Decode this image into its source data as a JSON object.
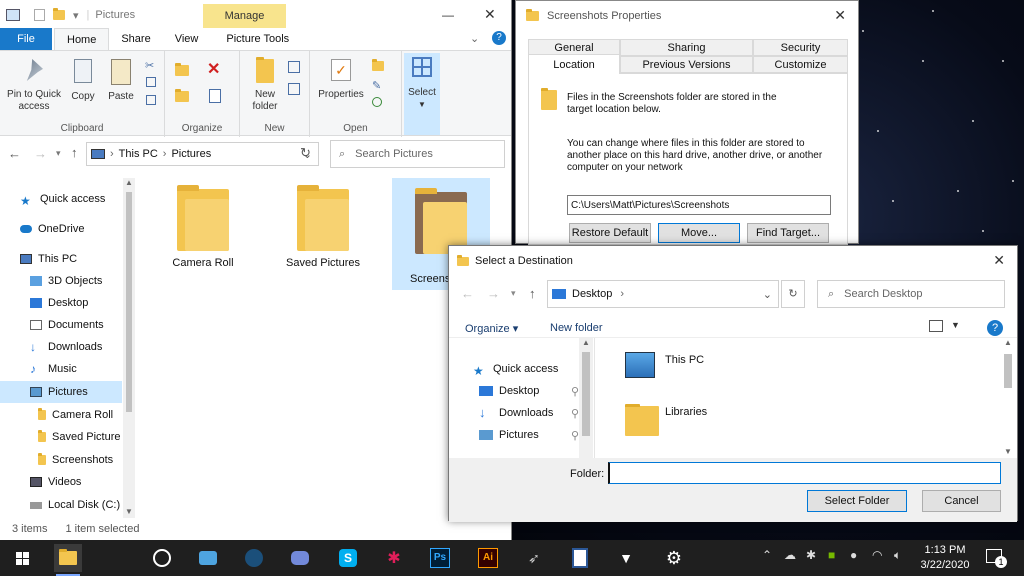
{
  "explorer": {
    "title": "Pictures",
    "manage_label": "Manage",
    "tabs": [
      "File",
      "Home",
      "Share",
      "View",
      "Picture Tools"
    ],
    "ribbon": {
      "pin": "Pin to Quick access",
      "copy": "Copy",
      "paste": "Paste",
      "new_folder": "New folder",
      "properties": "Properties",
      "select": "Select",
      "groups": [
        "Clipboard",
        "Organize",
        "New",
        "Open"
      ]
    },
    "address": {
      "parts": [
        "This PC",
        "Pictures"
      ]
    },
    "search_placeholder": "Search Pictures",
    "nav": [
      {
        "label": "Quick access"
      },
      {
        "label": "OneDrive"
      },
      {
        "label": "This PC"
      },
      {
        "label": "3D Objects"
      },
      {
        "label": "Desktop"
      },
      {
        "label": "Documents"
      },
      {
        "label": "Downloads"
      },
      {
        "label": "Music"
      },
      {
        "label": "Pictures"
      },
      {
        "label": "Camera Roll"
      },
      {
        "label": "Saved Picture"
      },
      {
        "label": "Screenshots"
      },
      {
        "label": "Videos"
      },
      {
        "label": "Local Disk (C:)"
      }
    ],
    "folders": [
      {
        "label": "Camera Roll"
      },
      {
        "label": "Saved Pictures"
      },
      {
        "label": "Screens"
      }
    ],
    "status": {
      "items": "3 items",
      "selected": "1 item selected"
    }
  },
  "props": {
    "title": "Screenshots Properties",
    "tabs": [
      "General",
      "Sharing",
      "Security",
      "Location",
      "Previous Versions",
      "Customize"
    ],
    "desc1": "Files in the Screenshots folder are stored in the target location below.",
    "desc2": "You can change where files in this folder are stored to another place on this hard drive, another drive, or another computer on your network",
    "path": "C:\\Users\\Matt\\Pictures\\Screenshots",
    "buttons": {
      "restore": "Restore Default",
      "move": "Move...",
      "find": "Find Target..."
    }
  },
  "dialog": {
    "title": "Select a Destination",
    "address": "Desktop",
    "search_placeholder": "Search Desktop",
    "organize": "Organize",
    "new_folder": "New folder",
    "nav": [
      {
        "label": "Quick access"
      },
      {
        "label": "Desktop"
      },
      {
        "label": "Downloads"
      },
      {
        "label": "Pictures"
      }
    ],
    "items": [
      {
        "label": "This PC"
      },
      {
        "label": "Libraries"
      }
    ],
    "folder_label": "Folder:",
    "folder_value": "",
    "select": "Select Folder",
    "cancel": "Cancel"
  },
  "taskbar": {
    "time": "1:13 PM",
    "date": "3/22/2020",
    "notifications": "1"
  },
  "colors": {
    "file_tab": "#1979ca",
    "accent": "#0078d7",
    "manage": "#f8e48d"
  }
}
